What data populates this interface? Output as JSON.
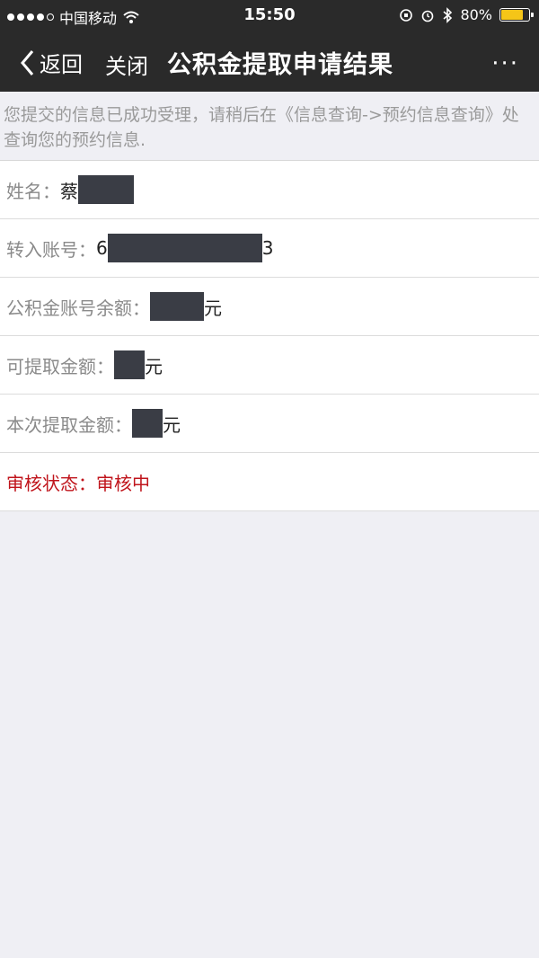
{
  "status_bar": {
    "carrier": "中国移动",
    "time": "15:50",
    "battery": "80%",
    "battery_level": 0.8
  },
  "nav": {
    "back_label": "返回",
    "close_label": "关闭",
    "title": "公积金提取申请结果",
    "more_label": "···"
  },
  "notice": "您提交的信息已成功受理，请稍后在《信息查询->预约信息查询》处查询您的预约信息.",
  "rows": [
    {
      "label": "姓名：",
      "prefix": "蔡",
      "suffix": ""
    },
    {
      "label": "转入账号：",
      "prefix": "6",
      "suffix": "3"
    },
    {
      "label": "公积金账号余额：",
      "prefix": "",
      "suffix": "元"
    },
    {
      "label": "可提取金额：",
      "prefix": "",
      "suffix": "元"
    },
    {
      "label": "本次提取金额：",
      "prefix": "",
      "suffix": "元"
    }
  ],
  "review_status": {
    "label": "审核状态：",
    "value": "审核中"
  },
  "colors": {
    "nav_bg": "#2a2a2a",
    "page_bg": "#efeff4",
    "status_red": "#c0151c",
    "battery_yellow": "#f5c518"
  }
}
